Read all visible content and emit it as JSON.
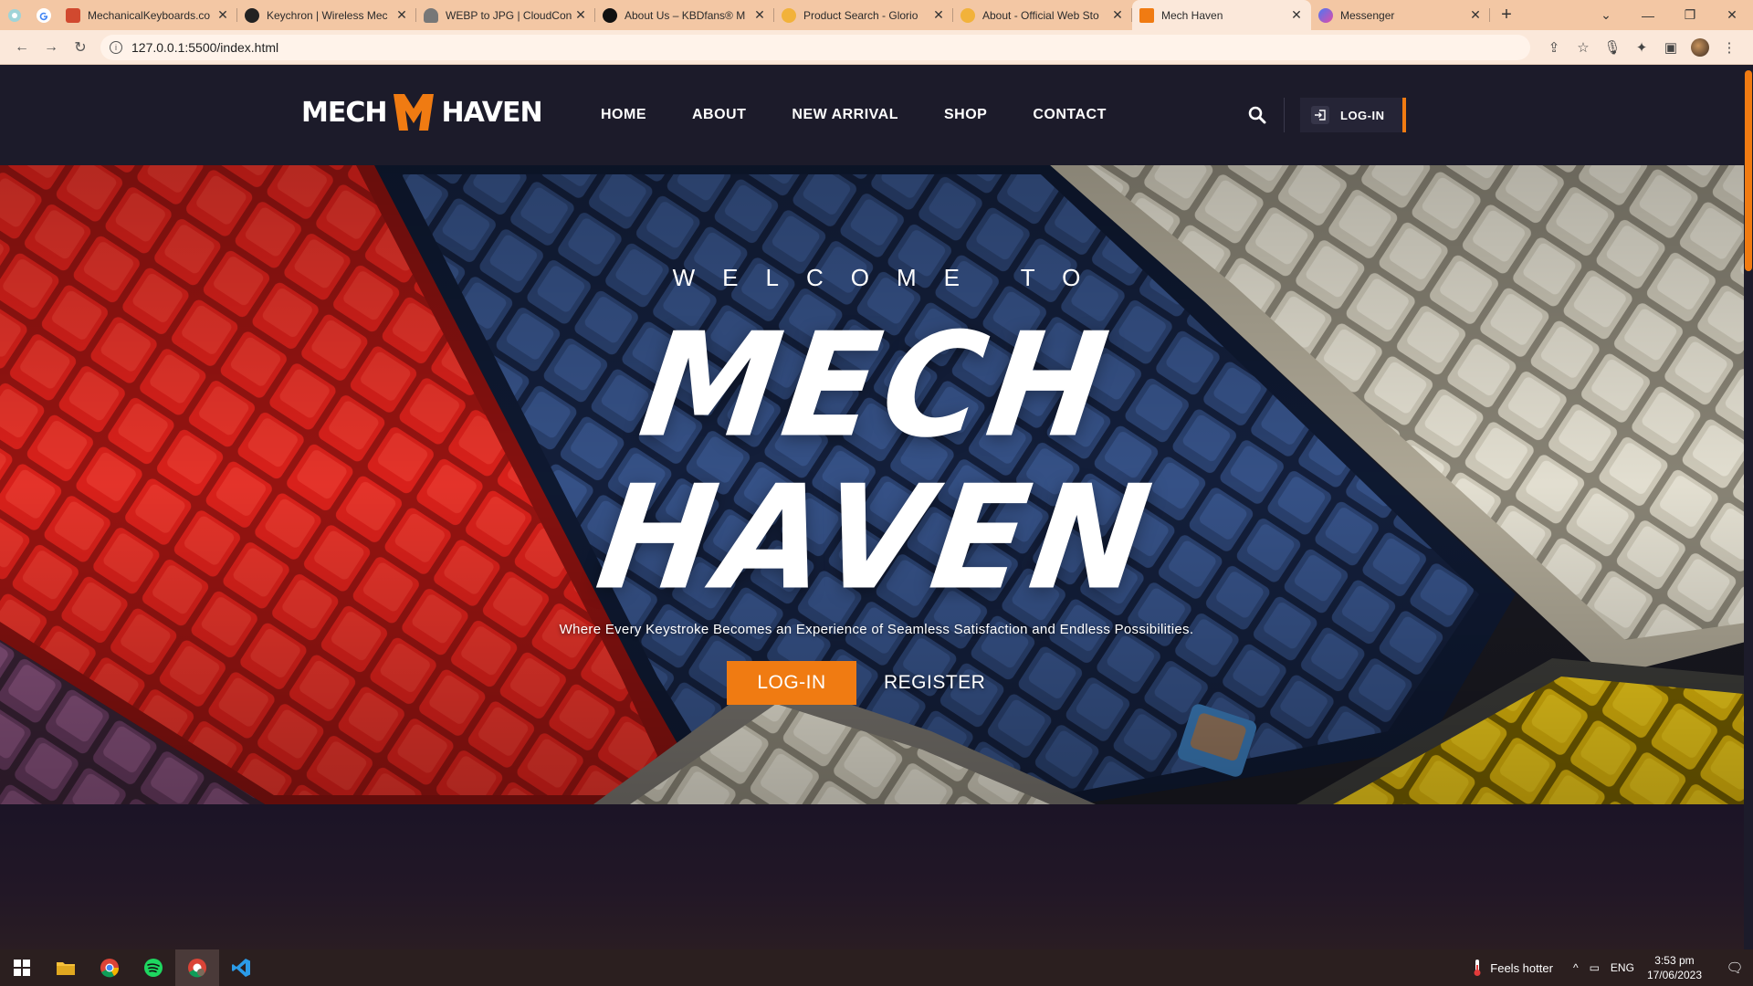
{
  "browser": {
    "tabs": [
      {
        "title": "MechanicalKeyboards.co",
        "fav_color": "#d1492f"
      },
      {
        "title": "Keychron | Wireless Mec",
        "fav_color": "#222222"
      },
      {
        "title": "WEBP to JPG | CloudCon",
        "fav_color": "#666666"
      },
      {
        "title": "About Us – KBDfans® M",
        "fav_color": "#111111"
      },
      {
        "title": "Product Search - Glorio",
        "fav_color": "#f2b23a"
      },
      {
        "title": "About - Official Web Sto",
        "fav_color": "#f2b23a"
      },
      {
        "title": "Mech Haven",
        "fav_color": "#f07b12",
        "active": true
      },
      {
        "title": "Messenger",
        "fav_color": "#a24bf0"
      }
    ],
    "url": "127.0.0.1:5500/index.html"
  },
  "site": {
    "logo": {
      "left": "MECH",
      "right": "HAVEN"
    },
    "nav": [
      {
        "label": "HOME"
      },
      {
        "label": "ABOUT"
      },
      {
        "label": "NEW ARRIVAL"
      },
      {
        "label": "SHOP"
      },
      {
        "label": "CONTACT"
      }
    ],
    "login_label": "LOG-IN",
    "hero": {
      "welcome": "WELCOME TO",
      "title_line1": "MECH",
      "title_line2": "HAVEN",
      "tagline": "Where Every Keystroke Becomes an Experience of Seamless Satisfaction and Endless Possibilities.",
      "login_button": "LOG-IN",
      "register_button": "REGISTER"
    },
    "accent": "#f07b12"
  },
  "taskbar": {
    "weather": "Feels hotter",
    "lang": "ENG",
    "time": "3:53 pm",
    "date": "17/06/2023"
  }
}
